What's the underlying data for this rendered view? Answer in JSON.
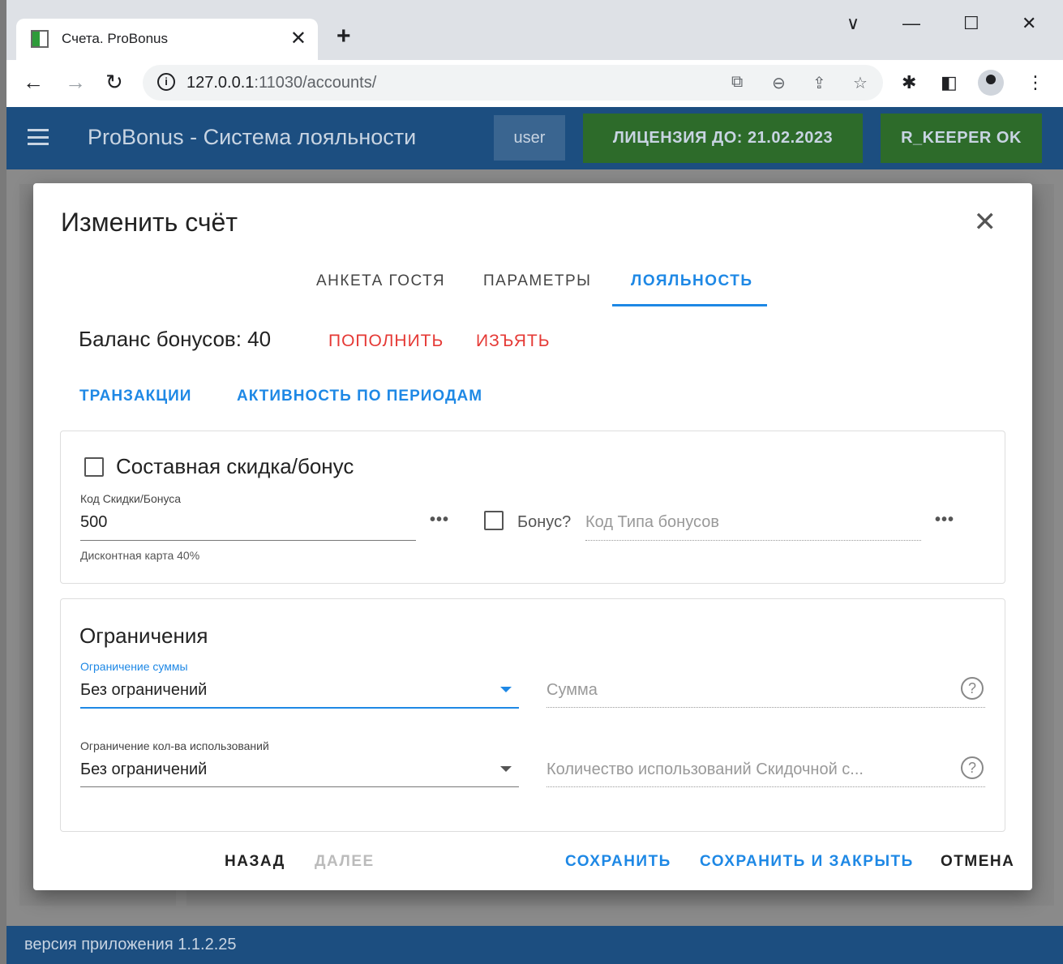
{
  "browser": {
    "tab_title": "Счета. ProBonus",
    "tab_close": "✕",
    "new_tab": "+",
    "url_host": "127.0.0.1",
    "url_path": ":11030/accounts/",
    "window_controls": [
      "∨",
      "—",
      "☐",
      "✕"
    ]
  },
  "app": {
    "title": "ProBonus - Система лояльности",
    "user": "user",
    "license": "ЛИЦЕНЗИЯ ДО: 21.02.2023",
    "rkeeper": "R_KEEPER OK",
    "footer": "версия приложения 1.1.2.25"
  },
  "dialog": {
    "title": "Изменить счёт",
    "close": "✕",
    "tabs": [
      "АНКЕТА ГОСТЯ",
      "ПАРАМЕТРЫ",
      "ЛОЯЛЬНОСТЬ"
    ],
    "active_tab": "ЛОЯЛЬНОСТЬ",
    "balance": "Баланс бонусов: 40",
    "topup": "ПОПОЛНИТЬ",
    "withdraw": "ИЗЪЯТЬ",
    "transactions": "ТРАНЗАКЦИИ",
    "activity": "АКТИВНОСТЬ ПО ПЕРИОДАМ",
    "discount": {
      "composite_label": "Составная скидка/бонус",
      "code_label": "Код Скидки/Бонуса",
      "code_value": "500",
      "code_hint": "Дисконтная карта 40%",
      "more": "•••",
      "bonus_label": "Бонус?",
      "bonus_type_placeholder": "Код Типа бонусов"
    },
    "limits": {
      "title": "Ограничения",
      "sum_limit_label": "Ограничение суммы",
      "sum_limit_value": "Без ограничений",
      "sum_placeholder": "Сумма",
      "count_limit_label": "Ограничение кол-ва использований",
      "count_limit_value": "Без ограничений",
      "count_placeholder": "Количество использований Скидочной с...",
      "help": "?"
    },
    "actions": {
      "back": "НАЗАД",
      "next": "ДАЛЕЕ",
      "save": "СОХРАНИТЬ",
      "save_close": "СОХРАНИТЬ И ЗАКРЫТЬ",
      "cancel": "ОТМЕНА"
    }
  },
  "colors": {
    "primary": "#1e88e5",
    "danger": "#e53935",
    "appbar": "#1c4e80",
    "success": "#2d6b2a"
  }
}
